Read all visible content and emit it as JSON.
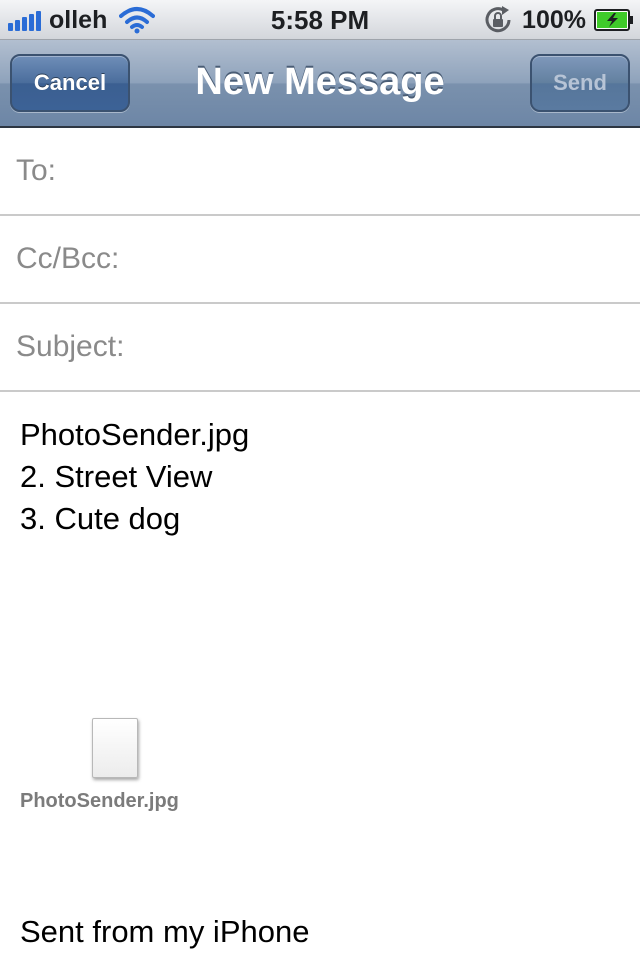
{
  "status_bar": {
    "carrier": "olleh",
    "time": "5:58 PM",
    "battery": "100%",
    "icons": {
      "signal": "signal-bars-icon",
      "wifi": "wifi-icon",
      "rotation_lock": "rotation-lock-icon",
      "battery": "battery-charging-icon"
    }
  },
  "nav_bar": {
    "title": "New Message",
    "cancel_label": "Cancel",
    "send_label": "Send"
  },
  "fields": {
    "to_label": "To:",
    "cc_label": "Cc/Bcc:",
    "subject_label": "Subject:"
  },
  "body": {
    "lines": [
      "PhotoSender.jpg",
      "2. Street View",
      "3. Cute dog"
    ],
    "attachment": {
      "name": "PhotoSender.jpg",
      "icon": "document-icon"
    },
    "signature": "Sent from my iPhone"
  },
  "colors": {
    "nav_gradient_top": "#b2bfd0",
    "nav_gradient_bottom": "#6d86a6",
    "field_label": "#8a8a8a",
    "signal_blue": "#2a6cd6",
    "battery_green": "#3fcb2a"
  }
}
